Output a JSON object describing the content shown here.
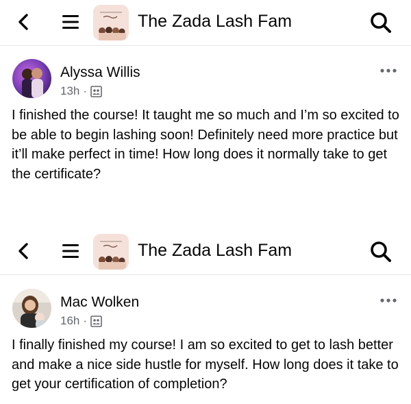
{
  "posts": [
    {
      "group_title": "The Zada Lash Fam",
      "author": "Alyssa Willis",
      "time": "13h",
      "separator": "·",
      "body": "I finished the course! It taught me so much and I’m so excited to be able to begin lashing soon! Definitely need more practice but it’ll make perfect in time! How long does it normally take to get the certificate?"
    },
    {
      "group_title": "The Zada Lash Fam",
      "author": "Mac Wolken",
      "time": "16h",
      "separator": "·",
      "body": "I finally finished my course! I am so excited to get to lash better and make a nice side hustle for myself. How long does it take to get your certification of completion?"
    }
  ],
  "icons": {
    "back": "chevron-left-icon",
    "menu": "hamburger-menu-icon",
    "search": "search-icon",
    "more": "more-dots-icon",
    "audience": "group-audience-icon"
  }
}
